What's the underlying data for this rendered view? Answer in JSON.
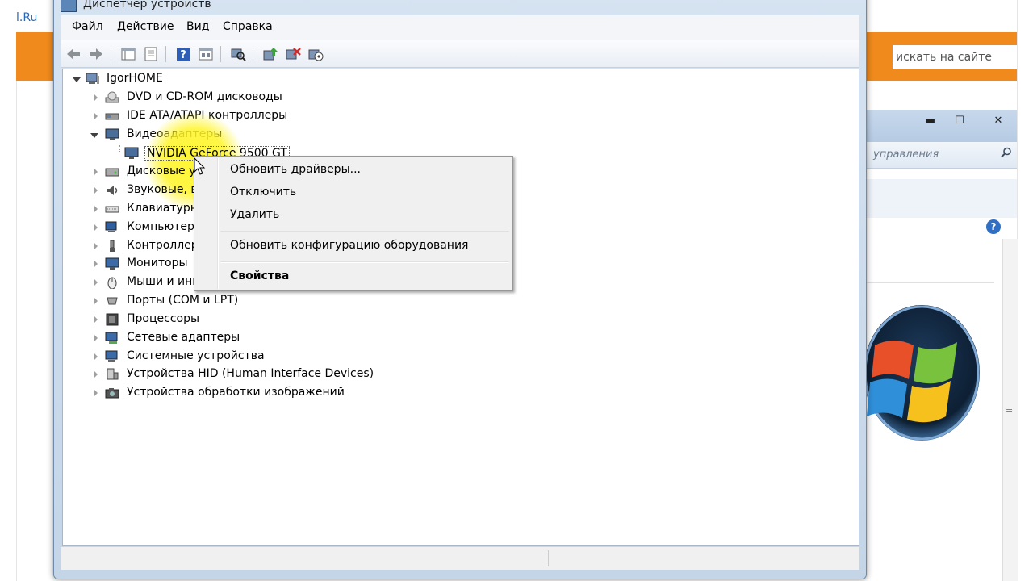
{
  "background": {
    "brand": "l.Ru",
    "search_placeholder": "искать на сайте",
    "accent_color": "#f08a1c"
  },
  "control_panel": {
    "minimize": "▬",
    "maximize": "☐",
    "close": "✕",
    "search_text": "управления",
    "help": "?"
  },
  "window": {
    "title": "Диспетчер устройств"
  },
  "menu": {
    "file": "Файл",
    "action": "Действие",
    "view": "Вид",
    "help": "Справка"
  },
  "tree": {
    "root": "IgorHOME",
    "items": [
      {
        "label": "DVD и CD-ROM дисководы",
        "icon": "dvd-drive-icon"
      },
      {
        "label": "IDE ATA/ATAPI контроллеры",
        "icon": "ide-controller-icon"
      },
      {
        "label": "Видеоадаптеры",
        "icon": "display-adapter-icon"
      },
      {
        "label": "NVIDIA GeForce 9500 GT",
        "icon": "display-adapter-icon"
      },
      {
        "label": "Дисковые устройства",
        "icon": "disk-drive-icon"
      },
      {
        "label": "Звуковые, видео и игровые устройства",
        "icon": "sound-icon"
      },
      {
        "label": "Клавиатуры",
        "icon": "keyboard-icon"
      },
      {
        "label": "Компьютер",
        "icon": "computer-icon"
      },
      {
        "label": "Контроллеры USB",
        "icon": "usb-icon"
      },
      {
        "label": "Мониторы",
        "icon": "monitor-icon"
      },
      {
        "label": "Мыши и иные указывающие устройства",
        "icon": "mouse-icon"
      },
      {
        "label": "Порты (COM и LPT)",
        "icon": "port-icon"
      },
      {
        "label": "Процессоры",
        "icon": "processor-icon"
      },
      {
        "label": "Сетевые адаптеры",
        "icon": "network-adapter-icon"
      },
      {
        "label": "Системные устройства",
        "icon": "system-device-icon"
      },
      {
        "label": "Устройства HID (Human Interface Devices)",
        "icon": "hid-icon"
      },
      {
        "label": "Устройства обработки изображений",
        "icon": "imaging-device-icon"
      }
    ]
  },
  "context_menu": {
    "update_drivers": "Обновить драйверы...",
    "disable": "Отключить",
    "uninstall": "Удалить",
    "scan": "Обновить конфигурацию оборудования",
    "properties": "Свойства"
  }
}
